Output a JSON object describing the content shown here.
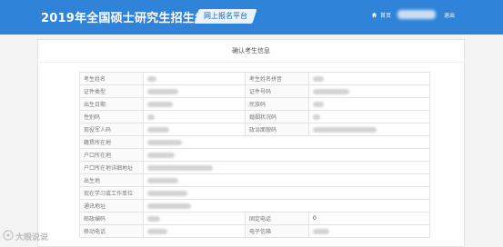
{
  "header": {
    "site_title": "2019年全国硕士研究生招生考试",
    "portal_badge": "网上报名平台",
    "home_label": "首页",
    "logout_label": "退出",
    "home_icon": "home-icon"
  },
  "panel": {
    "title": "确认考生信息"
  },
  "rows": [
    {
      "label": "考生姓名",
      "label2": "考生姓名拼音"
    },
    {
      "label": "证件类型",
      "label2": "证件号码"
    },
    {
      "label": "出生日期",
      "label2": "民族码"
    },
    {
      "label": "性别码",
      "label2": "婚姻状况码"
    },
    {
      "label": "现役军人码",
      "label2": "政治面貌码"
    },
    {
      "label": "籍贯所在地"
    },
    {
      "label": "户口所在地"
    },
    {
      "label": "户口所在地详细地址"
    },
    {
      "label": "出生地"
    },
    {
      "label": "现在学习或工作单位"
    },
    {
      "label": "通讯地址"
    },
    {
      "label": "邮政编码",
      "label2": "固定电话",
      "value2": "0"
    },
    {
      "label": "移动电话",
      "label2": "电子信箱"
    }
  ],
  "watermark": {
    "text": "大眼说说"
  }
}
